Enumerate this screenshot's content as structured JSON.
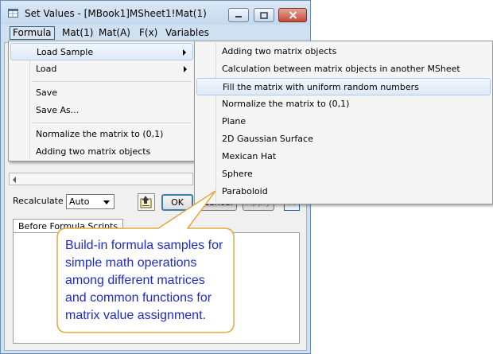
{
  "window": {
    "title": "Set Values - [MBook1]MSheet1!Mat(1)"
  },
  "menubar": {
    "items": [
      "Formula",
      "Mat(1)",
      "Mat(A)",
      "F(x)",
      "Variables"
    ]
  },
  "formula_menu": {
    "items": [
      "Load Sample",
      "Load",
      "Save",
      "Save As...",
      "Normalize the matrix to (0,1)",
      "Adding two matrix objects"
    ]
  },
  "load_sample_menu": {
    "items": [
      "Adding two matrix objects",
      "Calculation between matrix objects in another MSheet",
      "Fill the matrix with uniform random numbers",
      "Normalize the matrix to (0,1)",
      "Plane",
      "2D Gaussian Surface",
      "Mexican Hat",
      "Sphere",
      "Paraboloid"
    ]
  },
  "controls": {
    "recalculate_label": "Recalculate",
    "recalculate_value": "Auto",
    "ok_label": "OK",
    "cancel_label": "Cancel",
    "apply_label": "Apply",
    "tab_label": "Before Formula Scripts"
  },
  "callout": {
    "text": "Build-in formula samples for simple math operations among different matrices and common functions for matrix value assignment."
  },
  "colors": {
    "callout_text": "#1f2bc6",
    "callout_border": "#e2a93c",
    "titlebar": "#c5d9ee"
  }
}
